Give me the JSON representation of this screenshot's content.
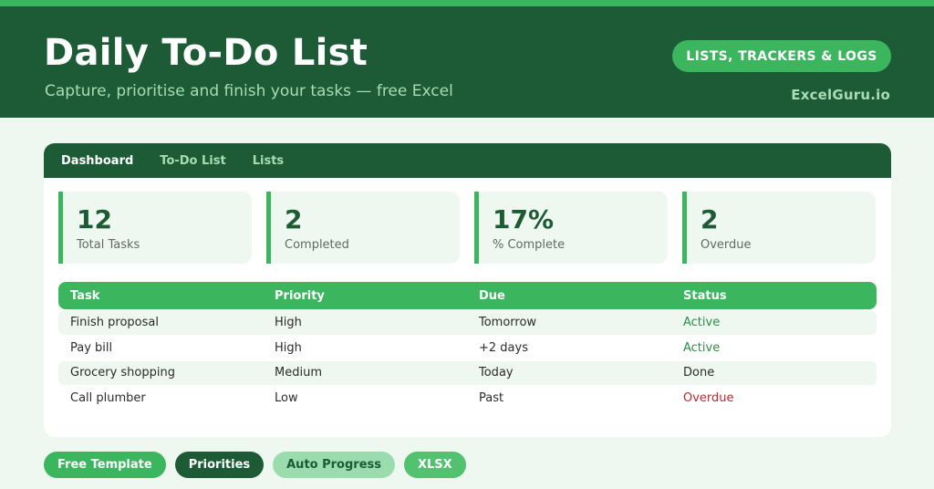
{
  "header": {
    "title": "Daily To-Do List",
    "subtitle": "Capture, prioritise and finish your tasks — free Excel",
    "pill": "LISTS, TRACKERS & LOGS",
    "brand": "ExcelGuru.io"
  },
  "tabs": [
    {
      "label": "Dashboard",
      "active": true
    },
    {
      "label": "To-Do List",
      "active": false
    },
    {
      "label": "Lists",
      "active": false
    }
  ],
  "stats": [
    {
      "value": "12",
      "label": "Total Tasks"
    },
    {
      "value": "2",
      "label": "Completed"
    },
    {
      "value": "17%",
      "label": "% Complete"
    },
    {
      "value": "2",
      "label": "Overdue"
    }
  ],
  "table": {
    "columns": [
      "Task",
      "Priority",
      "Due",
      "Status"
    ],
    "rows": [
      {
        "task": "Finish proposal",
        "priority": "High",
        "due": "Tomorrow",
        "status": "Active"
      },
      {
        "task": "Pay bill",
        "priority": "High",
        "due": "+2 days",
        "status": "Active"
      },
      {
        "task": "Grocery shopping",
        "priority": "Medium",
        "due": "Today",
        "status": "Done"
      },
      {
        "task": "Call plumber",
        "priority": "Low",
        "due": "Past",
        "status": "Overdue"
      }
    ]
  },
  "chips": [
    "Free Template",
    "Priorities",
    "Auto Progress",
    "XLSX"
  ],
  "colors": {
    "dark_green": "#1c5b35",
    "accent_green": "#3bb55e",
    "light_bg": "#eef7f0",
    "overdue_red": "#c0282d"
  }
}
